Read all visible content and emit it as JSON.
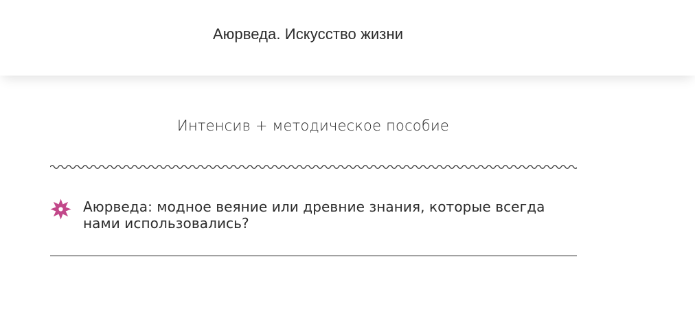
{
  "header": {
    "title": "Аюрведа. Искусство жизни"
  },
  "content": {
    "subtitle": "Интенсив + методическое пособие",
    "divider_icon": "wavy-divider",
    "items": [
      {
        "icon": "star-flower-icon",
        "icon_color": "#c2488a",
        "text": "Аюрведа: модное веяние или древние знания, которые всегда нами использовались?"
      }
    ]
  }
}
